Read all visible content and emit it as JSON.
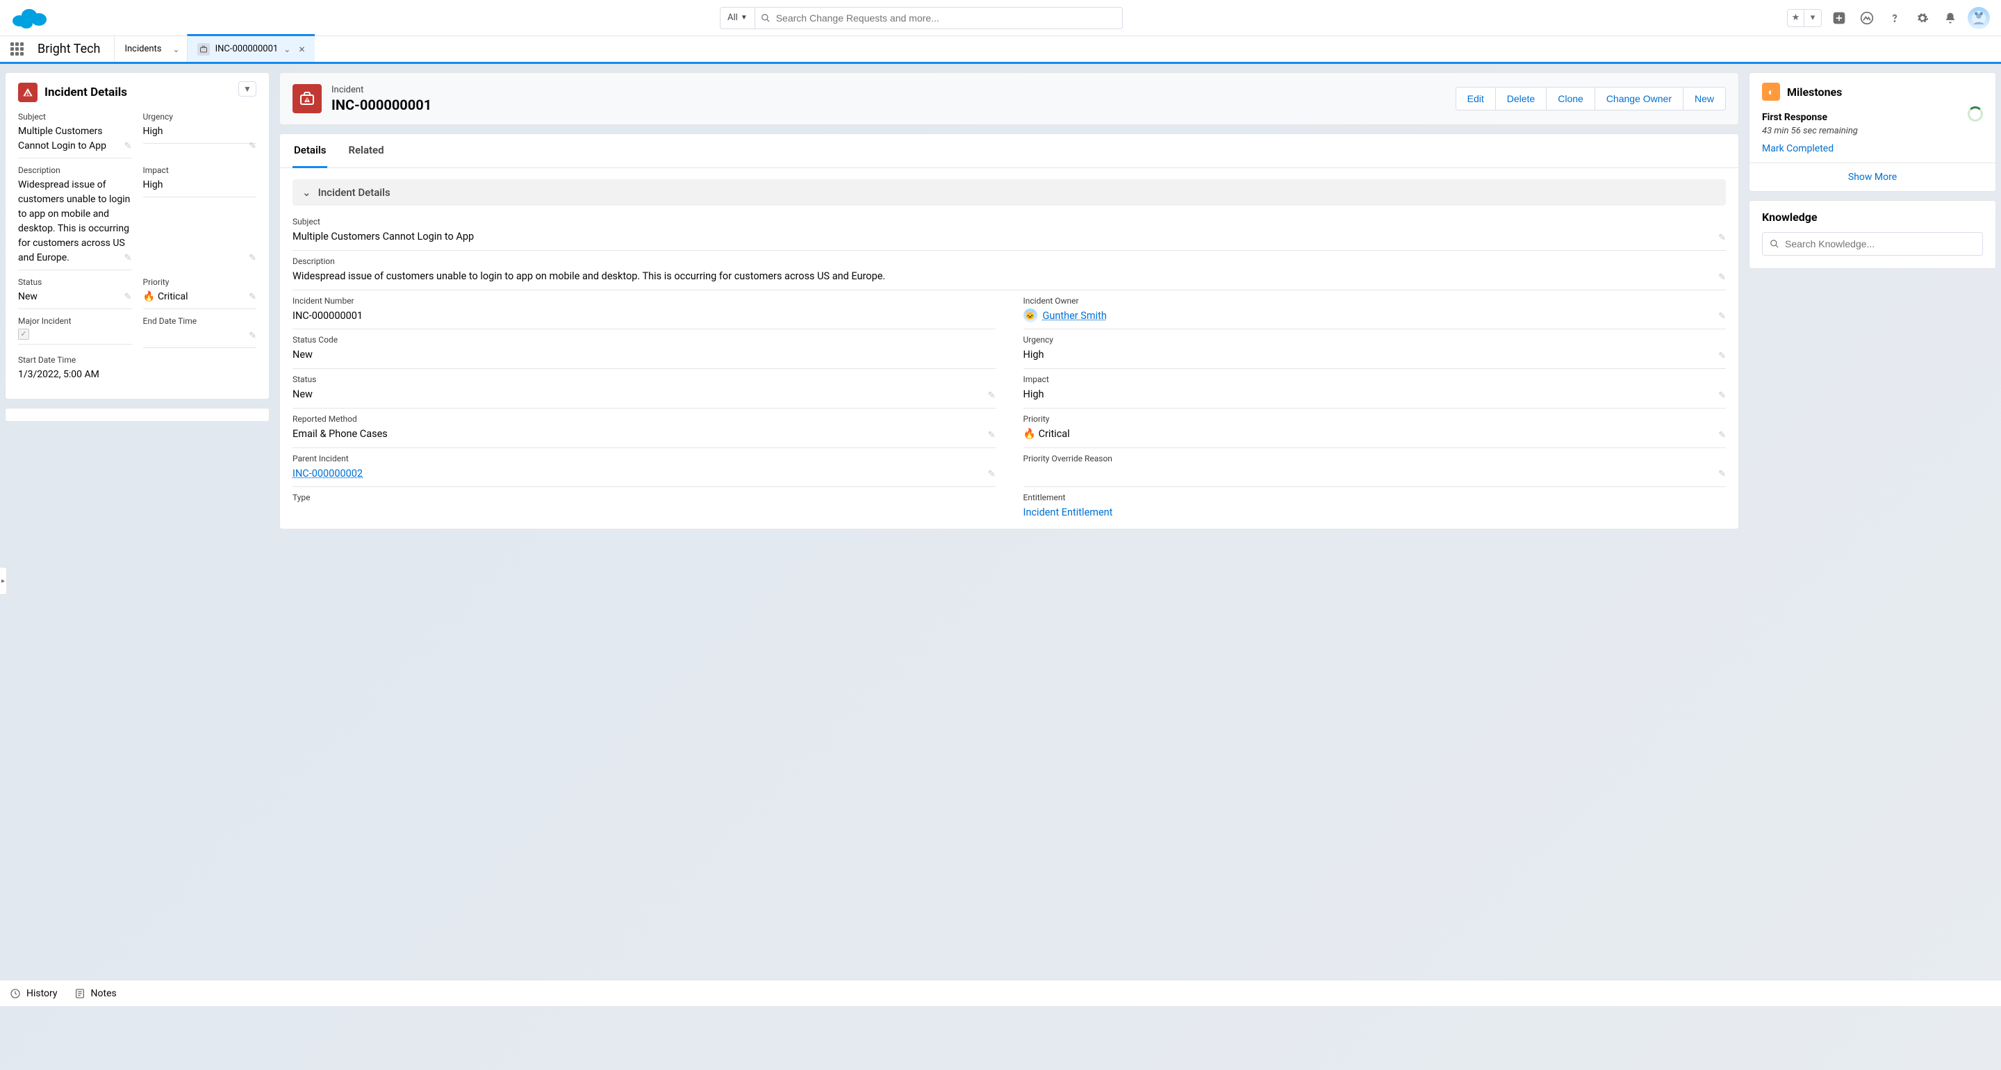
{
  "header": {
    "search_scope": "All",
    "search_placeholder": "Search Change Requests and more..."
  },
  "context": {
    "app_name": "Bright Tech",
    "tabs": [
      {
        "label": "Incidents"
      },
      {
        "label": "INC-000000001",
        "active": true
      }
    ]
  },
  "left_panel": {
    "title": "Incident Details",
    "fields": {
      "subject_label": "Subject",
      "subject_value": "Multiple Customers Cannot Login to App",
      "urgency_label": "Urgency",
      "urgency_value": "High",
      "description_label": "Description",
      "description_value": "Widespread issue of customers unable to login to app on mobile and desktop. This is occurring for customers across US and Europe.",
      "impact_label": "Impact",
      "impact_value": "High",
      "status_label": "Status",
      "status_value": "New",
      "priority_label": "Priority",
      "priority_value": "Critical",
      "major_incident_label": "Major Incident",
      "end_datetime_label": "End Date Time",
      "start_datetime_label": "Start Date Time",
      "start_datetime_value": "1/3/2022, 5:00 AM"
    }
  },
  "center": {
    "kicker": "Incident",
    "record_name": "INC-000000001",
    "actions": {
      "edit": "Edit",
      "delete": "Delete",
      "clone": "Clone",
      "change_owner": "Change Owner",
      "new": "New"
    },
    "tabs": {
      "details": "Details",
      "related": "Related"
    },
    "section_title": "Incident Details",
    "detail": {
      "subject_label": "Subject",
      "subject_value": "Multiple Customers Cannot Login to App",
      "description_label": "Description",
      "description_value": "Widespread issue of customers unable to login to app on mobile and desktop. This is occurring for customers across US and Europe.",
      "incident_number_label": "Incident Number",
      "incident_number_value": "INC-000000001",
      "incident_owner_label": "Incident Owner",
      "incident_owner_value": "Gunther Smith",
      "status_code_label": "Status Code",
      "status_code_value": "New",
      "urgency_label": "Urgency",
      "urgency_value": "High",
      "status_label": "Status",
      "status_value": "New",
      "impact_label": "Impact",
      "impact_value": "High",
      "reported_method_label": "Reported Method",
      "reported_method_value": "Email & Phone Cases",
      "priority_label": "Priority",
      "priority_value": "Critical",
      "parent_incident_label": "Parent Incident",
      "parent_incident_value": "INC-000000002",
      "priority_override_label": "Priority Override Reason",
      "type_label": "Type",
      "entitlement_label": "Entitlement",
      "entitlement_value": "Incident Entitlement"
    }
  },
  "right": {
    "milestones_title": "Milestones",
    "first_response": "First Response",
    "remaining": "43 min 56 sec remaining",
    "mark_completed": "Mark Completed",
    "show_more": "Show More",
    "knowledge_title": "Knowledge",
    "knowledge_placeholder": "Search Knowledge..."
  },
  "utility": {
    "history": "History",
    "notes": "Notes"
  }
}
